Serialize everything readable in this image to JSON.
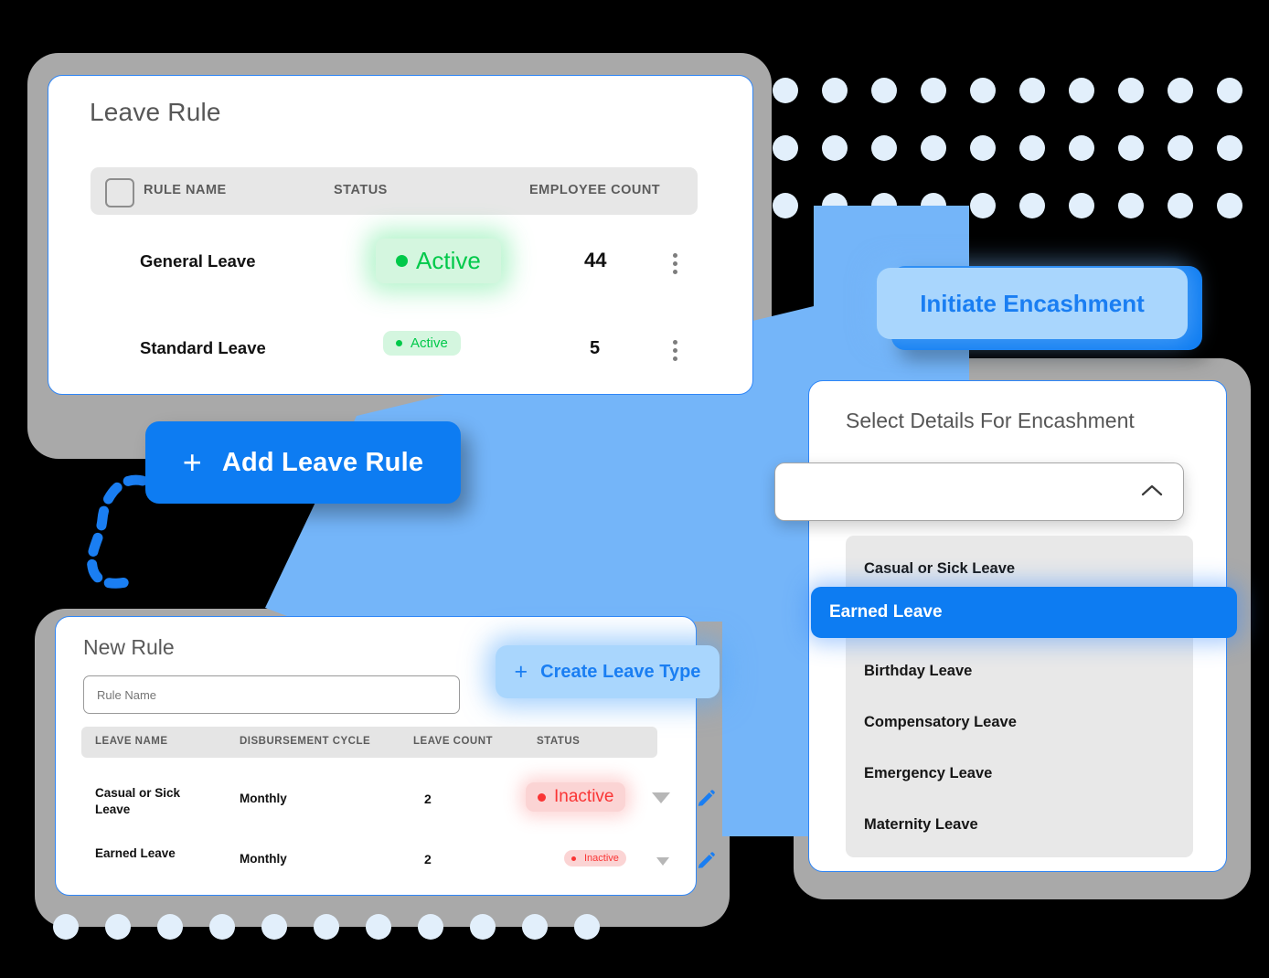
{
  "colors": {
    "accent_blue": "#0d7cf2",
    "light_blue": "#a9d6fd",
    "splash_blue": "#74b5f9",
    "frame_gray": "#a9a9a9",
    "dot_blue": "#e2effb",
    "active_green": "#00c94a",
    "active_green_bg": "#d4f6df",
    "inactive_red": "#fa3434",
    "inactive_red_bg": "#fbd4d4"
  },
  "leave_rule_card": {
    "title": "Leave Rule",
    "columns": [
      "RULE NAME",
      "STATUS",
      "EMPLOYEE COUNT"
    ],
    "rows": [
      {
        "name": "General Leave",
        "status": "Active",
        "count": "44"
      },
      {
        "name": "Standard Leave",
        "status": "Active",
        "count": "5"
      }
    ]
  },
  "add_leave_rule_button": {
    "icon": "plus-icon",
    "label": "Add Leave Rule"
  },
  "new_rule_card": {
    "title": "New Rule",
    "rule_name_input": {
      "value": "",
      "placeholder": "Rule Name"
    },
    "create_leave_type_button": {
      "icon": "plus-icon",
      "label": "Create Leave Type"
    },
    "columns": [
      "LEAVE NAME",
      "DISBURSEMENT CYCLE",
      "LEAVE COUNT",
      "STATUS"
    ],
    "rows": [
      {
        "name": "Casual or Sick Leave",
        "cycle": "Monthly",
        "count": "2",
        "status": "Inactive"
      },
      {
        "name": "Earned Leave",
        "cycle": "Monthly",
        "count": "2",
        "status": "Inactive"
      }
    ]
  },
  "initiate_encashment_button": {
    "label": "Initiate Encashment"
  },
  "encashment_card": {
    "title": "Select Details For Encashment",
    "select": {
      "value": "",
      "chevron": "chevron-up-icon"
    },
    "options": [
      {
        "label": "Casual or Sick Leave",
        "selected": false
      },
      {
        "label": "Earned Leave",
        "selected": true
      },
      {
        "label": "Birthday Leave",
        "selected": false
      },
      {
        "label": "Compensatory Leave",
        "selected": false
      },
      {
        "label": "Emergency Leave",
        "selected": false
      },
      {
        "label": "Maternity Leave",
        "selected": false
      }
    ]
  }
}
